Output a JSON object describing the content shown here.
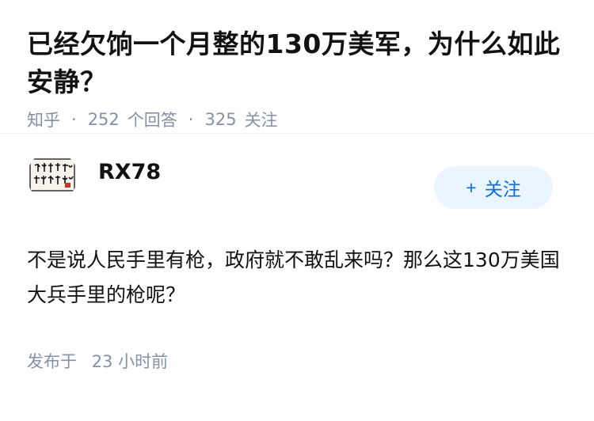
{
  "question": {
    "title": "已经欠饷一个月整的130万美军，为什么如此安静？",
    "source": "知乎",
    "answer_count": "252",
    "answer_label": "个回答",
    "follow_count": "325",
    "follow_label": "关注"
  },
  "answer": {
    "author_name": "RX78",
    "avatar_icon": "calligraphy-avatar-icon",
    "follow_button": "+ 关注",
    "follow_plus": "+",
    "follow_label": "关注",
    "content": "不是说人民手里有枪，政府就不敢乱来吗？那么这130万美国大兵手里的枪呢？",
    "posted_label": "发布于",
    "posted_time": "23 小时前"
  },
  "colors": {
    "accent": "#056de8",
    "button_bg": "#ebf5ff",
    "meta_text": "#8590a6",
    "title_text": "#121212"
  }
}
